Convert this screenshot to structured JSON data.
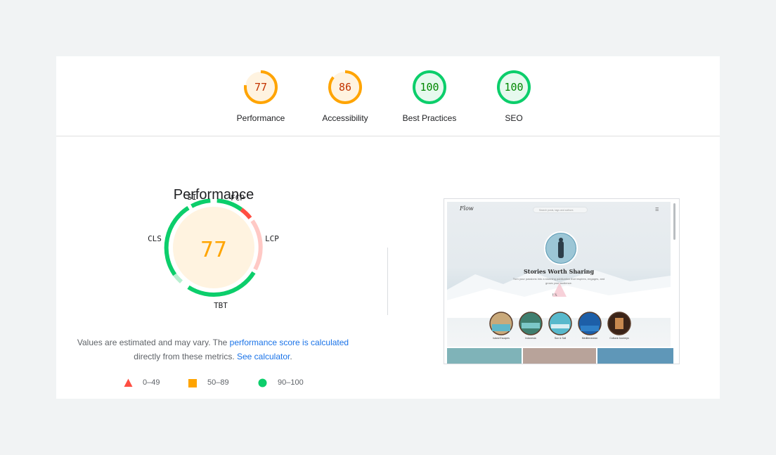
{
  "gauges": [
    {
      "score": "77",
      "label": "Performance",
      "value": 0.77,
      "status": "average"
    },
    {
      "score": "86",
      "label": "Accessibility",
      "value": 0.86,
      "status": "average"
    },
    {
      "score": "100",
      "label": "Best Practices",
      "value": 1.0,
      "status": "pass"
    },
    {
      "score": "100",
      "label": "SEO",
      "value": 1.0,
      "status": "pass"
    }
  ],
  "performance": {
    "score": "77",
    "title": "Performance",
    "metrics": {
      "si": "SI",
      "fcp": "FCP",
      "lcp": "LCP",
      "tbt": "TBT",
      "cls": "CLS"
    }
  },
  "note": {
    "text1": "Values are estimated and may vary. The ",
    "link1": "performance score is calculated",
    "text2": " directly from these metrics. ",
    "link2": "See calculator",
    "text3": "."
  },
  "legend": [
    {
      "range": "0–49",
      "shape": "triangle-icon"
    },
    {
      "range": "50–89",
      "shape": "square-icon"
    },
    {
      "range": "90–100",
      "shape": "circle-icon"
    }
  ],
  "screenshot": {
    "logo": "Flow",
    "search_placeholder": "Search posts, tags and authors",
    "hero_title": "Stories Worth Sharing",
    "hero_subtitle": "Turn your passions into a stunning publication that inspires, engages, and grows your audience.",
    "socials": "f   𝕏",
    "categories": [
      "Island Escapes",
      "Indonesia",
      "Sun & Sail",
      "Mediterranean",
      "Cultural Journeys"
    ]
  },
  "colors": {
    "average": "#ffa400",
    "average_bg": "#fff3e0",
    "average_text": "#c33300",
    "pass": "#0cce6b",
    "pass_bg": "#e6f9ee",
    "pass_text": "#008800",
    "fail": "#ff4e42"
  }
}
